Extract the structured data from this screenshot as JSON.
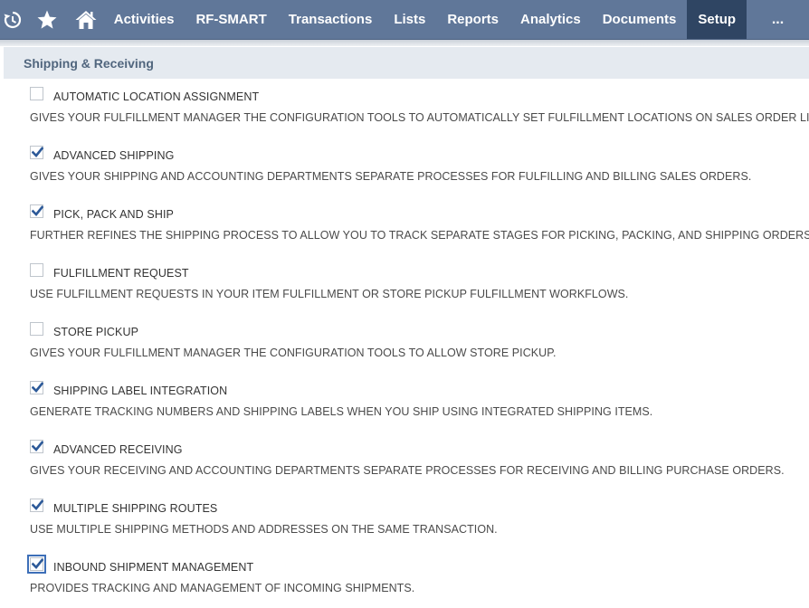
{
  "nav": {
    "items": [
      {
        "label": "Activities",
        "active": false
      },
      {
        "label": "RF-SMART",
        "active": false
      },
      {
        "label": "Transactions",
        "active": false
      },
      {
        "label": "Lists",
        "active": false
      },
      {
        "label": "Reports",
        "active": false
      },
      {
        "label": "Analytics",
        "active": false
      },
      {
        "label": "Documents",
        "active": false
      },
      {
        "label": "Setup",
        "active": true
      }
    ],
    "more_label": "...",
    "icons": [
      "recent-records-icon",
      "star-icon",
      "home-icon"
    ]
  },
  "section": {
    "title": "Shipping & Receiving"
  },
  "options": [
    {
      "label": "AUTOMATIC LOCATION ASSIGNMENT",
      "checked": false,
      "description": "GIVES YOUR FULFILLMENT MANAGER THE CONFIGURATION TOOLS TO AUTOMATICALLY SET FULFILLMENT LOCATIONS ON SALES ORDER LINES."
    },
    {
      "label": "ADVANCED SHIPPING",
      "checked": true,
      "description": "GIVES YOUR SHIPPING AND ACCOUNTING DEPARTMENTS SEPARATE PROCESSES FOR FULFILLING AND BILLING SALES ORDERS."
    },
    {
      "label": "PICK, PACK AND SHIP",
      "checked": true,
      "description": "FURTHER REFINES THE SHIPPING PROCESS TO ALLOW YOU TO TRACK SEPARATE STAGES FOR PICKING, PACKING, AND SHIPPING ORDERS."
    },
    {
      "label": "FULFILLMENT REQUEST",
      "checked": false,
      "description": "USE FULFILLMENT REQUESTS IN YOUR ITEM FULFILLMENT OR STORE PICKUP FULFILLMENT WORKFLOWS."
    },
    {
      "label": "STORE PICKUP",
      "checked": false,
      "description": "GIVES YOUR FULFILLMENT MANAGER THE CONFIGURATION TOOLS TO ALLOW STORE PICKUP."
    },
    {
      "label": "SHIPPING LABEL INTEGRATION",
      "checked": true,
      "description": "GENERATE TRACKING NUMBERS AND SHIPPING LABELS WHEN YOU SHIP USING INTEGRATED SHIPPING ITEMS."
    },
    {
      "label": "ADVANCED RECEIVING",
      "checked": true,
      "description": "GIVES YOUR RECEIVING AND ACCOUNTING DEPARTMENTS SEPARATE PROCESSES FOR RECEIVING AND BILLING PURCHASE ORDERS."
    },
    {
      "label": "MULTIPLE SHIPPING ROUTES",
      "checked": true,
      "description": "USE MULTIPLE SHIPPING METHODS AND ADDRESSES ON THE SAME TRANSACTION."
    },
    {
      "label": "INBOUND SHIPMENT MANAGEMENT",
      "checked": true,
      "focused": true,
      "description": "PROVIDES TRACKING AND MANAGEMENT OF INCOMING SHIPMENTS."
    }
  ],
  "colors": {
    "navbar": "#607799",
    "nav_active": "#2f4563",
    "section_header_bg": "#e5eaf0",
    "section_header_text": "#51667e",
    "checkmark": "#2d5a99"
  }
}
